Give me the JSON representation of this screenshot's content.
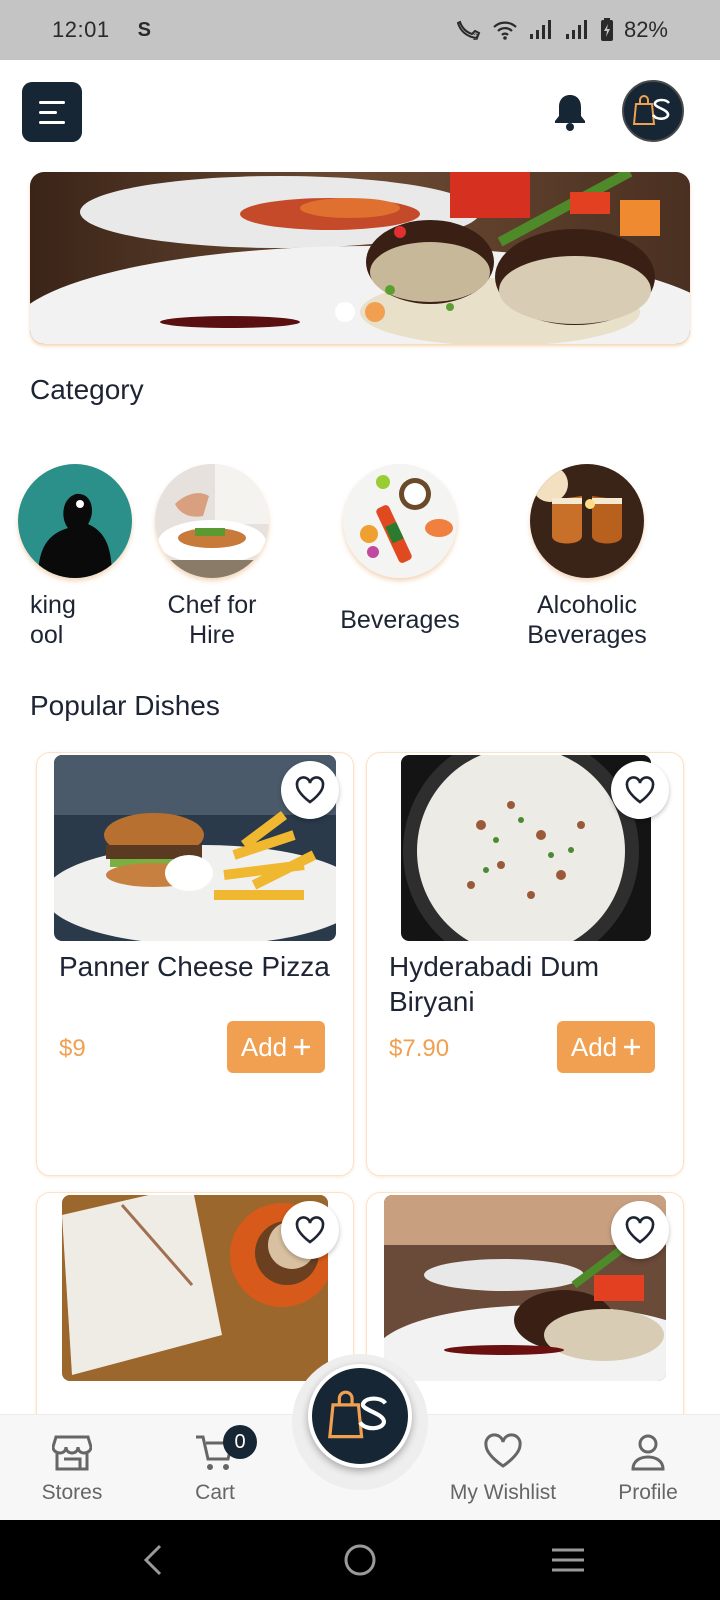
{
  "status_bar": {
    "time": "12:01",
    "sync_glyph": "S",
    "battery": "82%",
    "icons": [
      "call-icon",
      "wifi-icon",
      "signal-icon",
      "signal-icon",
      "battery-charging-icon"
    ]
  },
  "header": {
    "menu_icon": "menu-icon",
    "notification_icon": "bell-icon",
    "avatar_logo": "app-logo"
  },
  "banner": {
    "slides": 2,
    "active_slide": 2
  },
  "category": {
    "title": "Category",
    "items": [
      {
        "label_line1": "king",
        "label_line2": "ool"
      },
      {
        "label_line1": "Chef for",
        "label_line2": "Hire"
      },
      {
        "label_line1": "Beverages",
        "label_line2": ""
      },
      {
        "label_line1": "Alcoholic",
        "label_line2": "Beverages"
      }
    ]
  },
  "popular": {
    "title": "Popular Dishes",
    "dishes": [
      {
        "name": "Panner Cheese Pizza",
        "price": "$9",
        "add_label": "Add"
      },
      {
        "name": "Hyderabadi Dum Biryani",
        "price": "$7.90",
        "add_label": "Add"
      },
      {
        "name": "",
        "price": "",
        "add_label": ""
      },
      {
        "name": "",
        "price": "",
        "add_label": ""
      }
    ]
  },
  "bottom_nav": {
    "items": [
      {
        "label": "Stores",
        "icon": "store-icon"
      },
      {
        "label": "Cart",
        "icon": "cart-icon"
      },
      {
        "label": "My Wishlist",
        "icon": "heart-icon"
      },
      {
        "label": "Profile",
        "icon": "person-icon"
      }
    ],
    "cart_count": "0",
    "center_icon": "app-logo"
  },
  "colors": {
    "accent": "#f0a050",
    "navy": "#172634",
    "text": "#1d2433"
  }
}
